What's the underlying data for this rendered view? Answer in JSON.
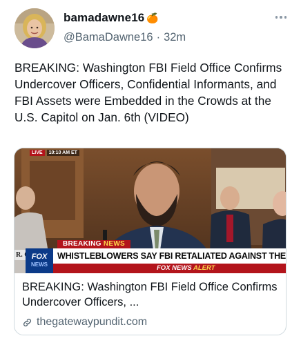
{
  "author": {
    "display_name": "bamadawne16",
    "name_emoji": "🍊",
    "handle": "@BamaDawne16",
    "separator": "·",
    "time": "32m"
  },
  "post": {
    "text": "BREAKING: Washington FBI Field Office Confirms Undercover Officers, Confidential Informants, and FBI Assets were Embedded in the Crowds at the U.S. Capitol on Jan. 6th (VIDEO)"
  },
  "card": {
    "title": "BREAKING: Washington FBI Field Office Confirms Undercover Officers, ...",
    "domain": "thegatewaypundit.com",
    "media": {
      "breaking_prefix": "BREAKING ",
      "breaking_suffix": "NEWS",
      "headline": "WHISTLEBLOWERS SAY FBI RETALIATED AGAINST THEM",
      "alert_prefix": "FOX NEWS ",
      "alert_suffix": "ALERT",
      "logo_top": "FOX",
      "logo_bottom": "NEWS",
      "chyron_fragment": "R. C",
      "live_label": "LIVE",
      "live_time": "10:10 AM ET"
    }
  },
  "icons": {
    "more": "more-horizontal-icon",
    "link": "link-icon"
  },
  "colors": {
    "text_primary": "#0f1419",
    "text_secondary": "#536471",
    "border": "#cfd9de",
    "fox_red": "#b3141b",
    "fox_blue": "#0b3a88"
  }
}
